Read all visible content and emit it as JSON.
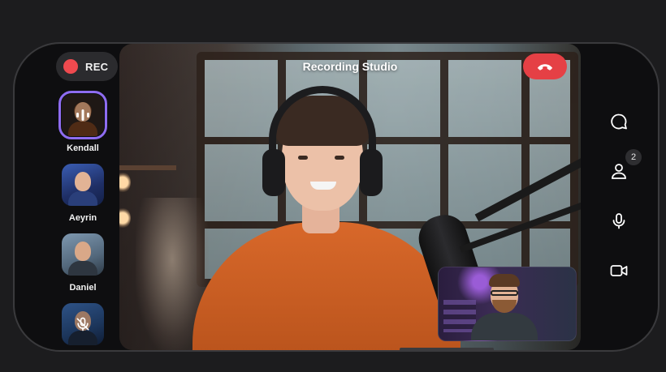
{
  "recording": {
    "label": "REC",
    "dot_color": "#ef4a4f"
  },
  "call": {
    "title": "Recording Studio",
    "end_color": "#e54045"
  },
  "participants": [
    {
      "name": "Kendall",
      "active": true,
      "status_icon": "speaking-icon"
    },
    {
      "name": "Aeyrin",
      "active": false
    },
    {
      "name": "Daniel",
      "active": false
    },
    {
      "name": "",
      "active": false,
      "status_icon": "mic-muted-icon"
    }
  ],
  "controls": {
    "chat_icon": "chat-bubble-icon",
    "participants_icon": "person-icon",
    "participants_count": "2",
    "mic_icon": "microphone-icon",
    "camera_icon": "video-camera-icon"
  },
  "accent_color": "#8e6cf0"
}
